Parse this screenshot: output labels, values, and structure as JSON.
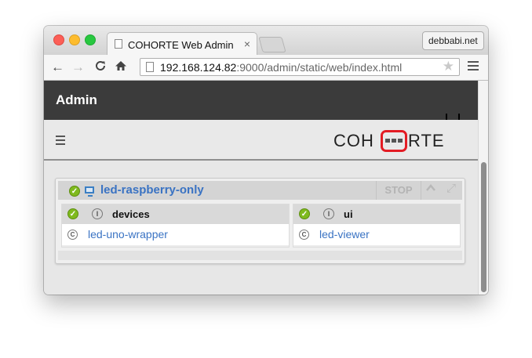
{
  "browser": {
    "tab_title": "COHORTE Web Admin",
    "tab_close": "×",
    "profile_name": "debbabi.net",
    "url_host": "192.168.124.82",
    "url_rest": ":9000/admin/static/web/index.html",
    "nav": {
      "back": "←",
      "forward": "→",
      "reload": "C",
      "home": "⌂",
      "star": "★"
    }
  },
  "app": {
    "admin_title": "Admin",
    "logo_left": "COH",
    "logo_right": "RTE",
    "brand_color": "#e31c24"
  },
  "node": {
    "name": "led-raspberry-only",
    "status_icon": "check-icon",
    "stop_label": "STOP",
    "up_icon": "^",
    "expand_icon": "⤢",
    "isolates": [
      {
        "name": "devices",
        "badge": "I",
        "component": "led-uno-wrapper",
        "component_badge": "C"
      },
      {
        "name": "ui",
        "badge": "I",
        "component": "led-viewer",
        "component_badge": "C"
      }
    ]
  },
  "colors": {
    "link": "#3a73c3",
    "ok_green": "#7fba1e",
    "header_dark": "#3b3b3b"
  }
}
